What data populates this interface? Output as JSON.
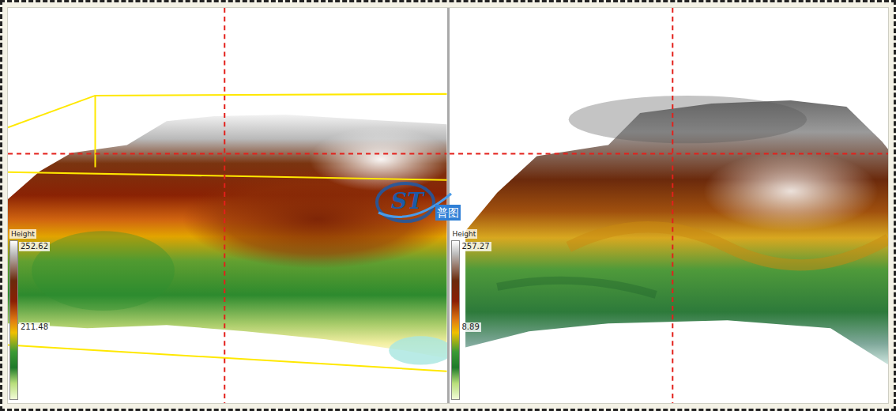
{
  "panels": [
    {
      "name": "point-cloud-view",
      "legend": {
        "title": "Height",
        "max": "252.62",
        "mid": "211.48"
      }
    },
    {
      "name": "terrain-view",
      "legend": {
        "title": "Height",
        "max": "257.27",
        "mid": "8.89"
      }
    }
  ],
  "logo": {
    "mark": "ST",
    "text": "普图"
  }
}
